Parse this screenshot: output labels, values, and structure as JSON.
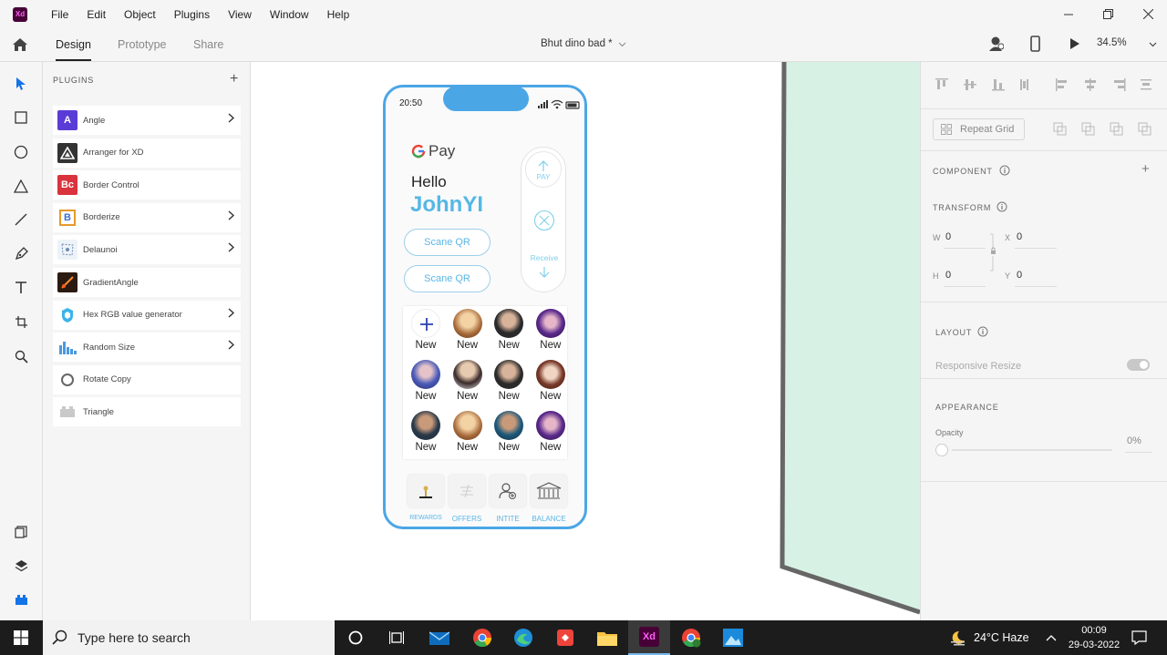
{
  "app": {
    "logo": "Xd",
    "menu": [
      "File",
      "Edit",
      "Object",
      "Plugins",
      "View",
      "Window",
      "Help"
    ]
  },
  "toolbar": {
    "tabs": [
      "Design",
      "Prototype",
      "Share"
    ],
    "doc_title": "Bhut dino bad *",
    "zoom": "34.5%"
  },
  "plugins": {
    "header": "PLUGINS",
    "items": [
      {
        "name": "Angle",
        "icon": "A",
        "color": "#5b3bd6",
        "has_chevron": true
      },
      {
        "name": "Arranger for XD",
        "icon": "",
        "color": "#333333",
        "has_chevron": false
      },
      {
        "name": "Border Control",
        "icon": "Bc",
        "color": "#d9333d",
        "has_chevron": false
      },
      {
        "name": "Borderize",
        "icon": "B",
        "color": "#ffffff",
        "has_chevron": true
      },
      {
        "name": "Delaunoi",
        "icon": "",
        "color": "#eef3f8",
        "has_chevron": true
      },
      {
        "name": "GradientAngle",
        "icon": "",
        "color": "#2a1a10",
        "has_chevron": false
      },
      {
        "name": "Hex RGB value generator",
        "icon": "",
        "color": "#ffffff",
        "has_chevron": true
      },
      {
        "name": "Random Size",
        "icon": "",
        "color": "#ffffff",
        "has_chevron": true
      },
      {
        "name": "Rotate Copy",
        "icon": "",
        "color": "#ffffff",
        "has_chevron": false
      },
      {
        "name": "Triangle",
        "icon": "",
        "color": "#ffffff",
        "has_chevron": false
      }
    ]
  },
  "phone": {
    "time": "20:50",
    "brand": "Pay",
    "greeting": "Hello",
    "user": "JohnYI",
    "buttons": [
      "Scane QR",
      "Scane QR"
    ],
    "pay_label": "PAY",
    "receive_label": "Receive",
    "grid_labels": [
      "New",
      "New",
      "New",
      "New",
      "New",
      "New",
      "New",
      "New",
      "New",
      "New",
      "New",
      "New"
    ],
    "nav": [
      "REWARDS",
      "OFFERS",
      "INTITE",
      "BALANCE"
    ],
    "accent": "#4ba6e6"
  },
  "properties": {
    "repeat_grid": "Repeat Grid",
    "component": "COMPONENT",
    "transform": "TRANSFORM",
    "w_label": "W",
    "w_value": "0",
    "x_label": "X",
    "x_value": "0",
    "h_label": "H",
    "h_value": "0",
    "y_label": "Y",
    "y_value": "0",
    "layout": "LAYOUT",
    "responsive_resize": "Responsive Resize",
    "appearance": "APPEARANCE",
    "opacity_label": "Opacity",
    "opacity_value": "0%"
  },
  "taskbar": {
    "search_placeholder": "Type here to search",
    "weather": "24°C  Haze",
    "time": "00:09",
    "date": "29-03-2022"
  }
}
